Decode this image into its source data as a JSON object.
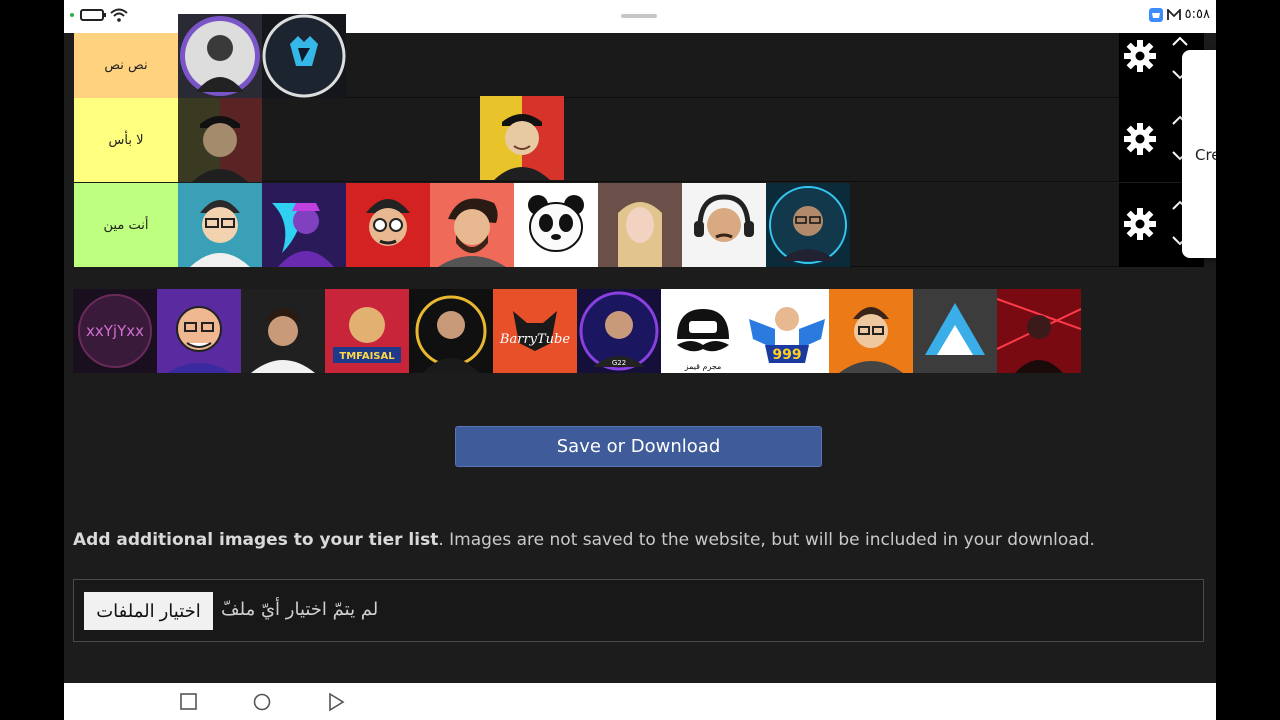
{
  "status_bar": {
    "clock": "٥:٥٨",
    "icons": [
      "notification-dot-icon",
      "battery-icon",
      "wifi-icon",
      "store-badge-icon",
      "mail-icon"
    ]
  },
  "tiers": [
    {
      "label": "نص نص",
      "color": "#ffd27f",
      "avatars": 2
    },
    {
      "label": "لا بأس",
      "color": "#ffff7f",
      "avatars": 2
    },
    {
      "label": "أنت مين",
      "color": "#bfff7f",
      "avatars": 8
    }
  ],
  "side_card": {
    "text": "Cre"
  },
  "pool": {
    "count": 12,
    "labels": [
      "xxYjYxx",
      "TMFAISAL",
      "BarryTube",
      "G22",
      "999",
      "مجرم قيمز"
    ]
  },
  "save_button": {
    "label": "Save or Download"
  },
  "info": {
    "bold": "Add additional images to your tier list",
    "rest": ". Images are not saved to the website, but will be included in your download."
  },
  "file_input": {
    "button_label": "اختيار الملفات",
    "status": "لم يتمّ اختيار أيّ ملفّ"
  },
  "colors": {
    "accent_button": "#3f5b99",
    "background": "#1c1c1c"
  }
}
